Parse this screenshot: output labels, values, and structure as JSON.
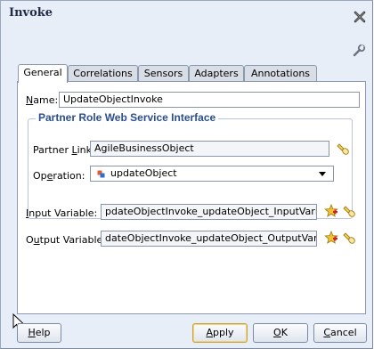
{
  "dialog": {
    "title": "Invoke"
  },
  "tabs": [
    {
      "label": "General",
      "active": true
    },
    {
      "label": "Correlations"
    },
    {
      "label": "Sensors"
    },
    {
      "label": "Adapters"
    },
    {
      "label": "Annotations"
    }
  ],
  "general": {
    "name_label_key": "N",
    "name_label_rest": "ame:",
    "name_value": "UpdateObjectInvoke",
    "group_title": "Partner Role Web Service Interface",
    "partner_link_label_a": "Partner ",
    "partner_link_label_key": "L",
    "partner_link_label_b": "ink:",
    "partner_link_value": "AgileBusinessObject",
    "operation_label_a": "Op",
    "operation_label_key": "e",
    "operation_label_b": "ration:",
    "operation_value": "updateObject",
    "input_variable_label_key": "I",
    "input_variable_label_rest": "nput Variable:",
    "input_variable_value": "pdateObjectInvoke_updateObject_InputVariable",
    "output_variable_label_a": "O",
    "output_variable_label_key": "u",
    "output_variable_label_b": "tput Variable:",
    "output_variable_value": "dateObjectInvoke_updateObject_OutputVariable"
  },
  "buttons": {
    "help_key": "H",
    "help_rest": "elp",
    "apply_key": "A",
    "apply_rest": "pply",
    "ok_key": "O",
    "ok_rest": "K",
    "cancel_key": "C",
    "cancel_rest": "ancel"
  },
  "icons": {
    "close": "close-icon",
    "wrench": "wrench-icon",
    "flashlight": "flashlight-icon",
    "create_variable": "create-variable-icon",
    "operation": "operation-icon"
  },
  "colors": {
    "dialog_bg": "#e8eef7",
    "group_title": "#2b4e8f",
    "primary_button_border": "#c9a23a"
  }
}
